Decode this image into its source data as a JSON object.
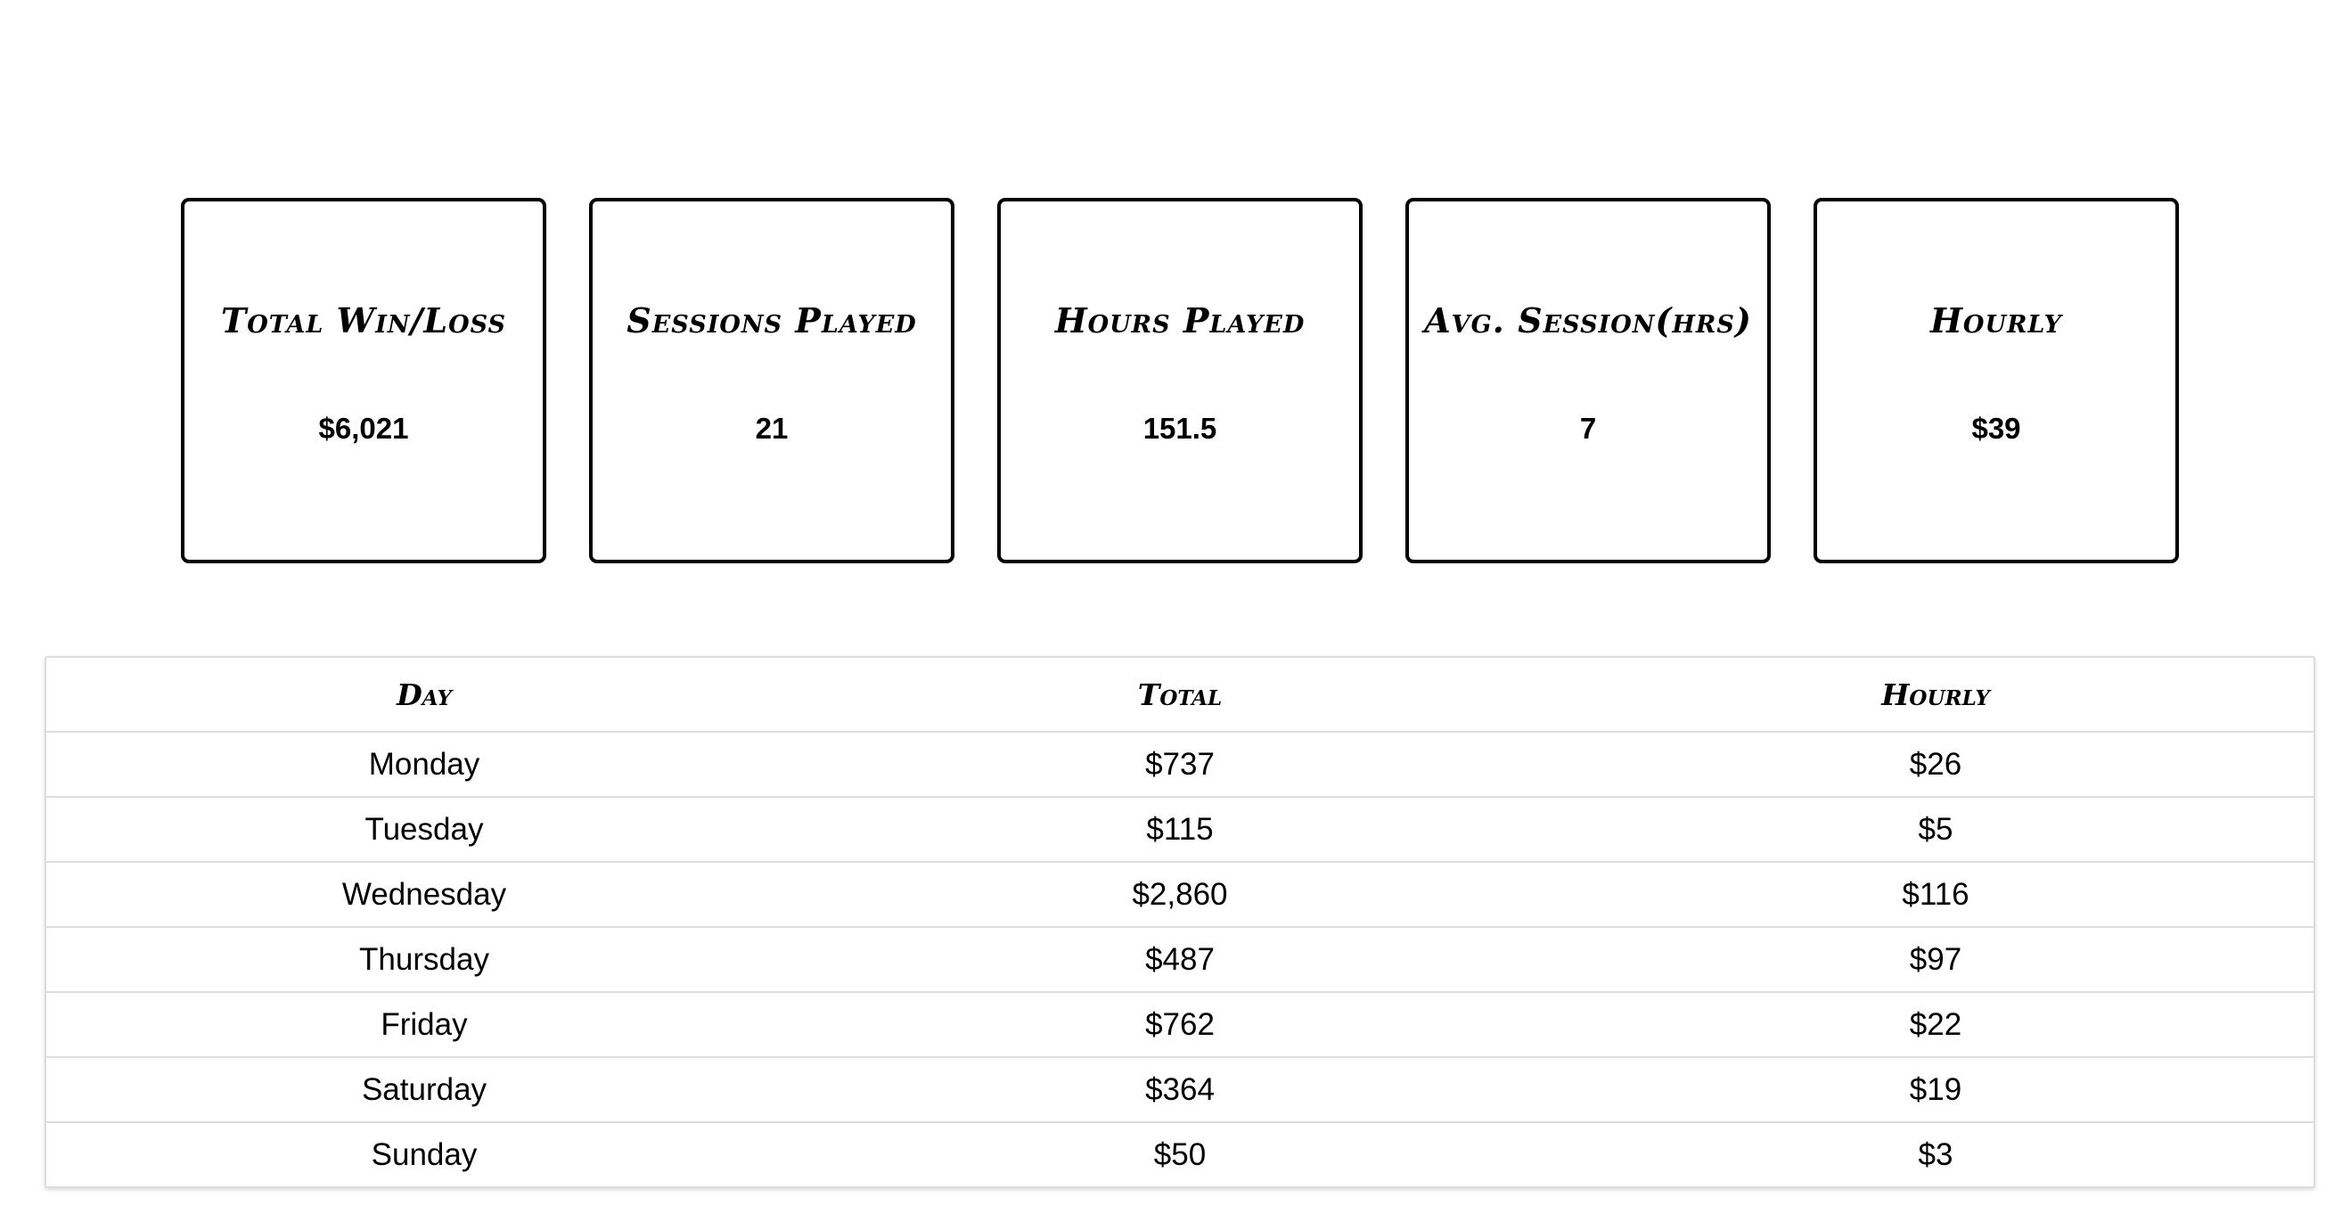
{
  "summary_cards": [
    {
      "title": "Total Win/Loss",
      "value": "$6,021"
    },
    {
      "title": "Sessions Played",
      "value": "21"
    },
    {
      "title": "Hours Played",
      "value": "151.5"
    },
    {
      "title": "Avg. Session(hrs)",
      "value": "7"
    },
    {
      "title": "Hourly",
      "value": "$39"
    }
  ],
  "day_table": {
    "headers": [
      "Day",
      "Total",
      "Hourly"
    ],
    "rows": [
      {
        "day": "Monday",
        "total": "$737",
        "hourly": "$26"
      },
      {
        "day": "Tuesday",
        "total": "$115",
        "hourly": "$5"
      },
      {
        "day": "Wednesday",
        "total": "$2,860",
        "hourly": "$116"
      },
      {
        "day": "Thursday",
        "total": "$487",
        "hourly": "$97"
      },
      {
        "day": "Friday",
        "total": "$762",
        "hourly": "$22"
      },
      {
        "day": "Saturday",
        "total": "$364",
        "hourly": "$19"
      },
      {
        "day": "Sunday",
        "total": "$50",
        "hourly": "$3"
      }
    ]
  }
}
